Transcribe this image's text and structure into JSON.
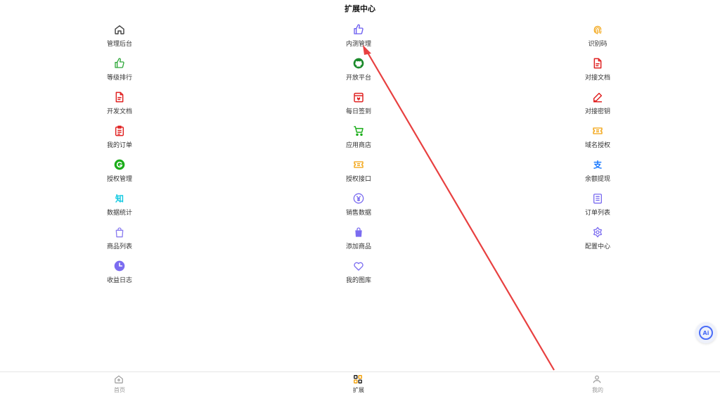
{
  "page": {
    "title": "扩展中心"
  },
  "columns": [
    [
      {
        "label": "管理后台",
        "icon": "home-icon",
        "color": "#444444"
      },
      {
        "label": "等级排行",
        "icon": "thumbs-up-icon",
        "color": "#2fa83a"
      },
      {
        "label": "开发文档",
        "icon": "document-icon",
        "color": "#e02020"
      },
      {
        "label": "我的订单",
        "icon": "clipboard-icon",
        "color": "#e02020"
      },
      {
        "label": "授权管理",
        "icon": "g-circle-icon",
        "color": "#1aad19"
      },
      {
        "label": "数据统计",
        "icon": "zhi-icon",
        "color": "#0ec8e0"
      },
      {
        "label": "商品列表",
        "icon": "bag-outline-icon",
        "color": "#8a7cf0"
      },
      {
        "label": "收益日志",
        "icon": "clock-icon",
        "color": "#7b6cf0"
      }
    ],
    [
      {
        "label": "内测管理",
        "icon": "thumbs-up-icon",
        "color": "#6a5cf0"
      },
      {
        "label": "开放平台",
        "icon": "github-icon",
        "color": "#1a8a2a"
      },
      {
        "label": "每日签到",
        "icon": "calendar-icon",
        "color": "#e02020"
      },
      {
        "label": "应用商店",
        "icon": "cart-icon",
        "color": "#1aad19"
      },
      {
        "label": "授权接口",
        "icon": "ticket-icon",
        "color": "#f2a10a"
      },
      {
        "label": "销售数据",
        "icon": "yuan-circle-icon",
        "color": "#7b6cf0"
      },
      {
        "label": "添加商品",
        "icon": "bag-filled-icon",
        "color": "#7b6cf0"
      },
      {
        "label": "我的图库",
        "icon": "heart-icon",
        "color": "#7b6cf0"
      }
    ],
    [
      {
        "label": "识别码",
        "icon": "fingerprint-icon",
        "color": "#f2a10a"
      },
      {
        "label": "对接文档",
        "icon": "document-icon",
        "color": "#e02020"
      },
      {
        "label": "对接密钥",
        "icon": "pencil-icon",
        "color": "#e02020"
      },
      {
        "label": "域名授权",
        "icon": "ticket-icon",
        "color": "#f2a10a"
      },
      {
        "label": "余额提现",
        "icon": "alipay-icon",
        "color": "#1677ff"
      },
      {
        "label": "订单列表",
        "icon": "list-doc-icon",
        "color": "#7b6cf0"
      },
      {
        "label": "配置中心",
        "icon": "flower-gear-icon",
        "color": "#7b6cf0"
      }
    ]
  ],
  "ai_button": {
    "label": "Ai"
  },
  "tabbar": [
    {
      "label": "首页",
      "icon": "home-icon",
      "active": false
    },
    {
      "label": "扩展",
      "icon": "grid-icon",
      "active": true
    },
    {
      "label": "我的",
      "icon": "user-icon",
      "active": false
    }
  ],
  "colors": {
    "arrow": "#e84040",
    "tab_active": "#f2a10a",
    "tab_inactive": "#999999"
  }
}
